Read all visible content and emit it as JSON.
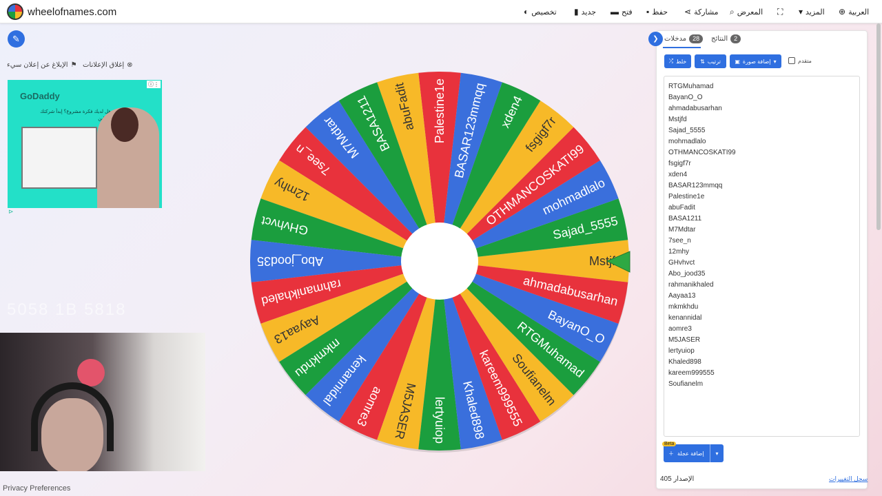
{
  "header": {
    "site_name": "wheelofnames.com",
    "menu": [
      {
        "label": "تخصيص",
        "icon": "palette-icon",
        "glyph": "◐"
      },
      {
        "label": "جديد",
        "icon": "new-file-icon",
        "glyph": "▮"
      },
      {
        "label": "فتح",
        "icon": "folder-icon",
        "glyph": "▬"
      },
      {
        "label": "حفظ",
        "icon": "save-icon",
        "glyph": "▪"
      },
      {
        "label": "مشاركة",
        "icon": "share-icon",
        "glyph": "⋖"
      },
      {
        "label": "المعرض",
        "icon": "search-icon",
        "glyph": "⌕"
      },
      {
        "label": "",
        "icon": "fullscreen-icon",
        "glyph": "⛶"
      },
      {
        "label": "المزيد",
        "icon": "chevron-down-icon",
        "glyph": "▾"
      },
      {
        "label": "العربية",
        "icon": "globe-icon",
        "glyph": "⊕"
      }
    ]
  },
  "ads": {
    "report_label": "الإبلاغ عن إعلان سيء",
    "close_label": "إغلاق الإعلانات",
    "ad_brand": "GoDaddy",
    "ad_text": "هل لديك فكرة مشروع؟ إبدأ شركتك اونلاين"
  },
  "overlay_text": "5058 1B 5818",
  "footer": {
    "privacy": "Privacy Preferences"
  },
  "wheel": {
    "colors": [
      "#f7b928",
      "#1b9e3e",
      "#3a6fdc",
      "#e8323c"
    ],
    "pointer_color": "#2ea843",
    "segments": [
      "Mstjfd",
      "Sajad_5555",
      "mohmadlalo",
      "OTHMANCOSKATI99",
      "fsgigf7r",
      "xden4",
      "BASAR123mmqq",
      "Palestine1e",
      "abuFadit",
      "BASA1211",
      "M7Mdtar",
      "7see_n",
      "12mhy",
      "GHvhvct",
      "Abo_jood35",
      "rahmanikhaled",
      "Aayaa13",
      "mkmkhdu",
      "kenannidal",
      "aomre3",
      "M5JASER",
      "lertyuiop",
      "Khaled898",
      "kareem999555",
      "Soufianelm",
      "RTGMuhamad",
      "BayanO_O",
      "ahmadabusarhan"
    ]
  },
  "panel": {
    "tab_entries": "مدخلات",
    "entries_count": "28",
    "tab_results": "النتائج",
    "results_count": "2",
    "shuffle_label": "خلط",
    "sort_label": "ترتيب",
    "add_image_label": "إضافة صورة",
    "advanced_label": "متقدم",
    "add_wheel_label": "إضافة عجلة",
    "beta_label": "Beta",
    "version_label": "الإصدار 405",
    "changelog_label": "سجل التغييرات",
    "entries": [
      "RTGMuhamad",
      "BayanO_O",
      "ahmadabusarhan",
      "Mstjfd",
      "Sajad_5555",
      "mohmadlalo",
      "OTHMANCOSKATI99",
      "fsgigf7r",
      "xden4",
      "BASAR123mmqq",
      "Palestine1e",
      "abuFadit",
      "BASA1211",
      "M7Mdtar",
      "7see_n",
      "12mhy",
      "GHvhvct",
      "Abo_jood35",
      "rahmanikhaled",
      "Aayaa13",
      "mkmkhdu",
      "kenannidal",
      "aomre3",
      "M5JASER",
      "lertyuiop",
      "Khaled898",
      "kareem999555",
      "Soufianelm"
    ]
  }
}
